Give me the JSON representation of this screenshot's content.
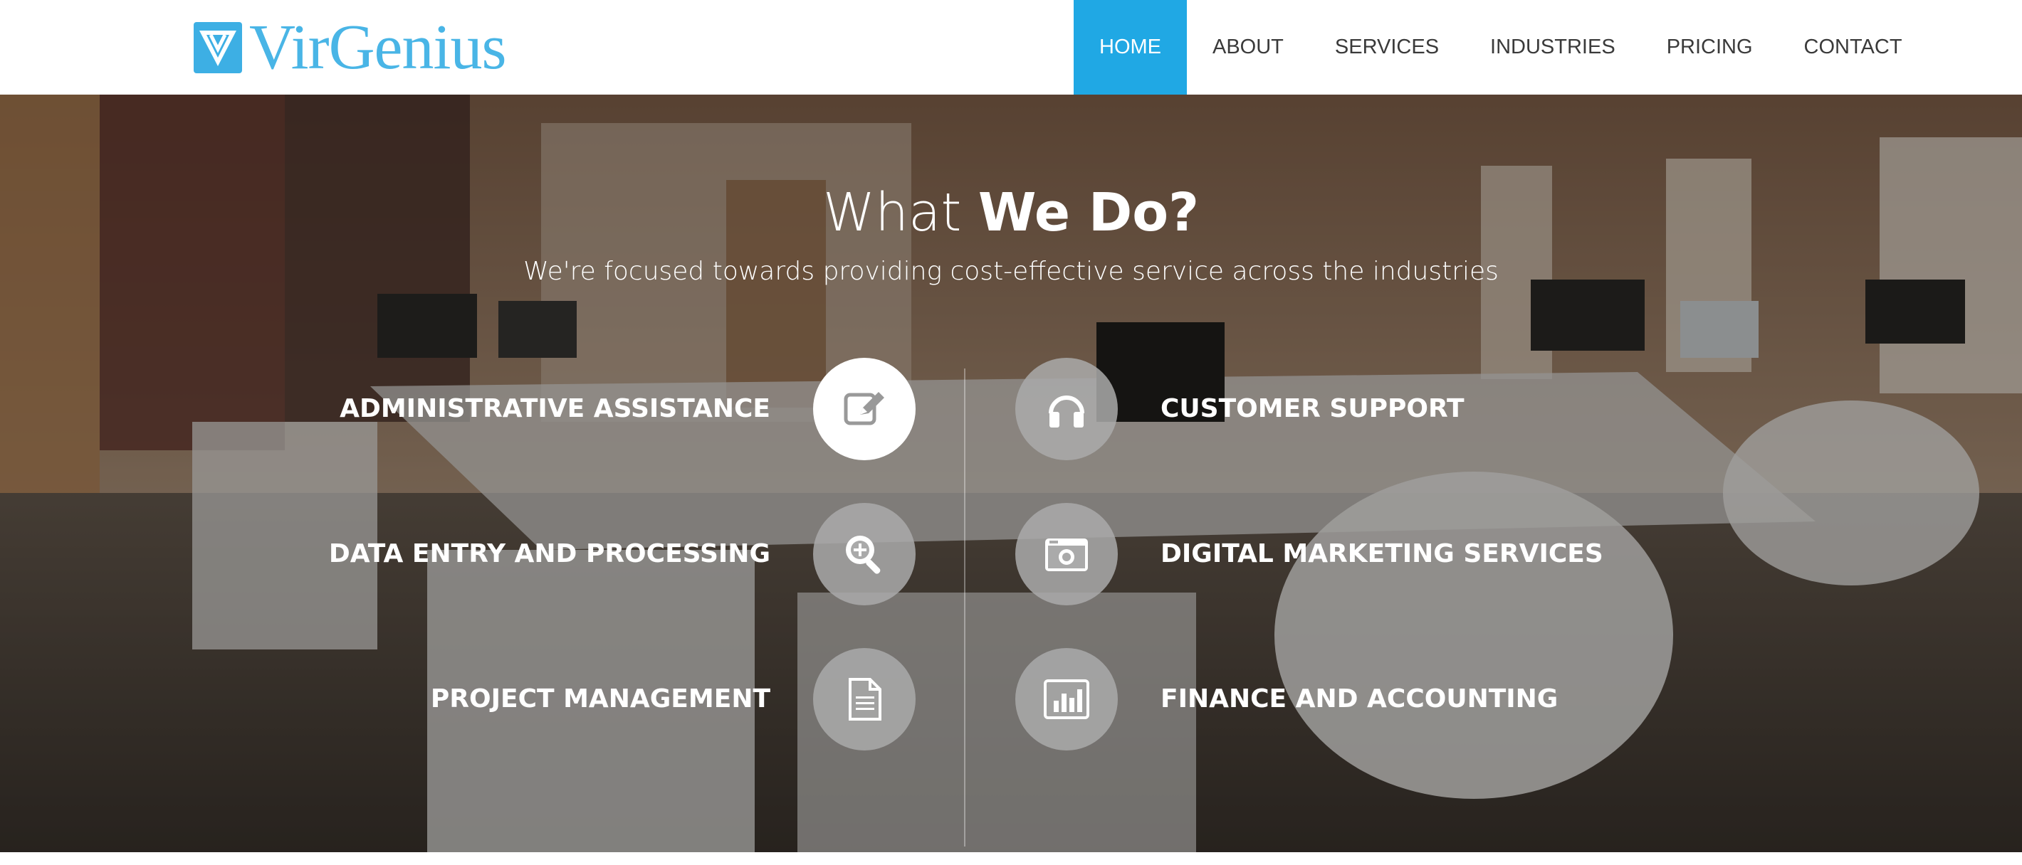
{
  "brand": {
    "name": "VirGenius",
    "logo_icon": "v-logo-icon",
    "color": "#49b5e6"
  },
  "nav": {
    "items": [
      {
        "label": "HOME",
        "active": true
      },
      {
        "label": "ABOUT",
        "active": false
      },
      {
        "label": "SERVICES",
        "active": false
      },
      {
        "label": "INDUSTRIES",
        "active": false
      },
      {
        "label": "PRICING",
        "active": false
      },
      {
        "label": "CONTACT",
        "active": false
      }
    ],
    "active_color": "#20a8e4"
  },
  "hero": {
    "title_light": "What ",
    "title_bold": "We Do?",
    "subtitle": "We're focused towards providing cost-effective service across the industries"
  },
  "services": {
    "left": [
      {
        "label": "ADMINISTRATIVE ASSISTANCE",
        "icon": "edit-icon",
        "active": true
      },
      {
        "label": "DATA ENTRY AND PROCESSING",
        "icon": "search-plus-icon",
        "active": false
      },
      {
        "label": "PROJECT MANAGEMENT",
        "icon": "document-icon",
        "active": false
      }
    ],
    "right": [
      {
        "label": "CUSTOMER SUPPORT",
        "icon": "headphones-icon",
        "active": false
      },
      {
        "label": "DIGITAL MARKETING SERVICES",
        "icon": "camera-icon",
        "active": false
      },
      {
        "label": "FINANCE AND ACCOUNTING",
        "icon": "bar-chart-icon",
        "active": false
      }
    ]
  }
}
